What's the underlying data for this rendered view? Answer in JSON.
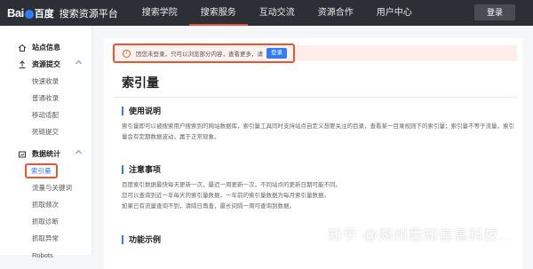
{
  "header": {
    "logo_text": "Bai",
    "logo_du": "百度",
    "logo_sub": "搜索资源平台",
    "nav": [
      "搜索学院",
      "搜索服务",
      "互动交流",
      "资源合作",
      "用户中心"
    ],
    "login": "登录"
  },
  "sidebar": {
    "groups": [
      {
        "label": "站点信息",
        "icon": "home-icon",
        "items": []
      },
      {
        "label": "资源提交",
        "icon": "upload-icon",
        "items": [
          "快速收录",
          "普通收录",
          "移动适配",
          "死链提交"
        ]
      },
      {
        "label": "数据统计",
        "icon": "chart-icon",
        "items": [
          "索引量",
          "流量与关键词",
          "抓取频次",
          "抓取诊断",
          "抓取异常",
          "Robots"
        ]
      }
    ],
    "active_item": "索引量"
  },
  "alert": {
    "message": "因您未登录，只可以浏览部分内容，查看更多，请",
    "login_button": "登录"
  },
  "main": {
    "title": "索引量",
    "section1_title": "使用说明",
    "section1_text": "索引量即可以被搜索用户搜索到的网站数据库，索引量工具同时支持站点自定义想要关注的目录，查看某一目录规则下的索引量；索引量不等于流量，索引量会有定期数据波动，属于正常现象。",
    "section2_title": "注意事项",
    "section2_lines": [
      "百度索引数据最快每天更新一次，最迟一周更新一次，不同站点的更新日期可能不同。",
      "您可以查询到近一年每天的索引量数据，一年前的索引量数据为每月索引量数据。",
      "如果已有流量查询不到，请隔日再查，最长间隔一周可查询到数据。"
    ],
    "section3_title": "功能示例"
  },
  "watermark": "知乎 @郑州悉知信息科技..."
}
